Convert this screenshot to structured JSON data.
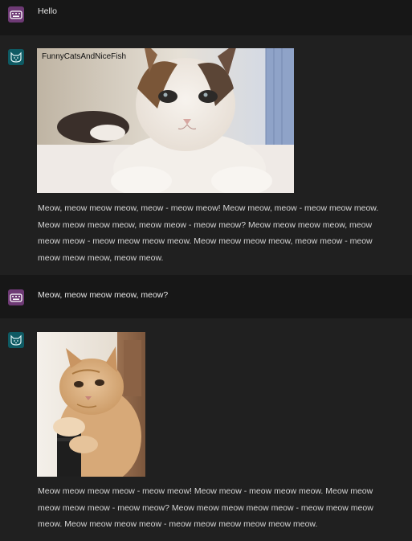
{
  "messages": [
    {
      "role": "user",
      "text": "Hello",
      "avatar_icon": "keyboard-icon"
    },
    {
      "role": "assistant",
      "avatar_icon": "cat-icon",
      "image_caption": "FunnyCatsAndNiceFish",
      "text": "Meow, meow meow meow, meow - meow meow! Meow meow, meow - meow meow meow. Meow meow meow meow, meow meow - meow meow? Meow meow meow meow, meow meow meow - meow meow meow meow. Meow meow meow meow, meow meow - meow meow meow meow, meow meow."
    },
    {
      "role": "user",
      "text": "Meow, meow meow meow, meow?",
      "avatar_icon": "keyboard-icon"
    },
    {
      "role": "assistant",
      "avatar_icon": "cat-icon",
      "text": "Meow meow meow meow - meow meow! Meow meow - meow meow meow. Meow meow meow meow meow - meow meow? Meow meow meow meow meow - meow meow meow meow. Meow meow meow meow - meow meow meow meow meow meow."
    }
  ],
  "colors": {
    "user_bg": "#171717",
    "assistant_bg": "#202020",
    "user_avatar": "#6e3a75",
    "assistant_avatar": "#0e5a63",
    "text": "#d6d6d6"
  }
}
